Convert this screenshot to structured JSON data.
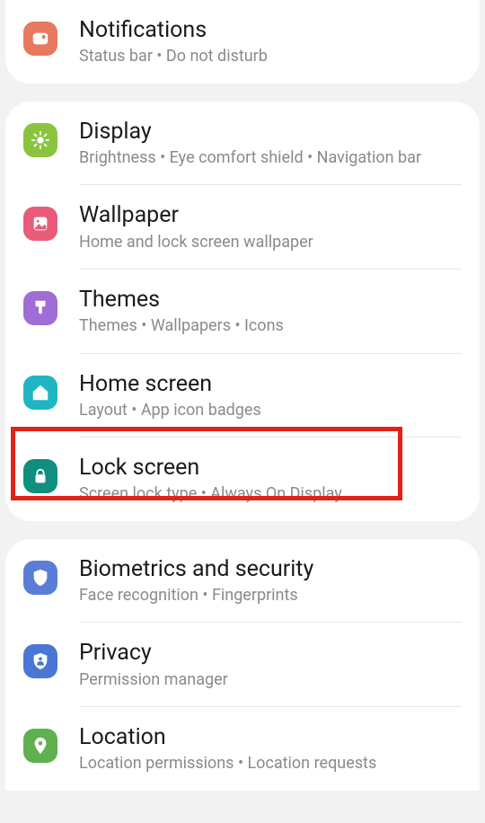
{
  "groups": [
    {
      "items": [
        {
          "id": "notifications",
          "title": "Notifications",
          "subtitle": "Status bar  •  Do not disturb",
          "icon": "message-icon",
          "color": "bg-coral"
        }
      ]
    },
    {
      "items": [
        {
          "id": "display",
          "title": "Display",
          "subtitle": "Brightness  •  Eye comfort shield  •  Navigation bar",
          "icon": "sun-icon",
          "color": "bg-green"
        },
        {
          "id": "wallpaper",
          "title": "Wallpaper",
          "subtitle": "Home and lock screen wallpaper",
          "icon": "image-icon",
          "color": "bg-pink"
        },
        {
          "id": "themes",
          "title": "Themes",
          "subtitle": "Themes  •  Wallpapers  •  Icons",
          "icon": "brush-icon",
          "color": "bg-purple"
        },
        {
          "id": "homescreen",
          "title": "Home screen",
          "subtitle": "Layout  •  App icon badges",
          "icon": "home-icon",
          "color": "bg-teal"
        },
        {
          "id": "lockscreen",
          "title": "Lock screen",
          "subtitle": "Screen lock type  •  Always On Display",
          "icon": "lock-icon",
          "color": "bg-darkteal",
          "highlighted": true
        }
      ]
    },
    {
      "items": [
        {
          "id": "biometrics",
          "title": "Biometrics and security",
          "subtitle": "Face recognition  •  Fingerprints",
          "icon": "shield-icon",
          "color": "bg-blue"
        },
        {
          "id": "privacy",
          "title": "Privacy",
          "subtitle": "Permission manager",
          "icon": "privacy-icon",
          "color": "bg-blue2"
        },
        {
          "id": "location",
          "title": "Location",
          "subtitle": "Location permissions  •  Location requests",
          "icon": "pin-icon",
          "color": "bg-green2"
        }
      ]
    }
  ]
}
